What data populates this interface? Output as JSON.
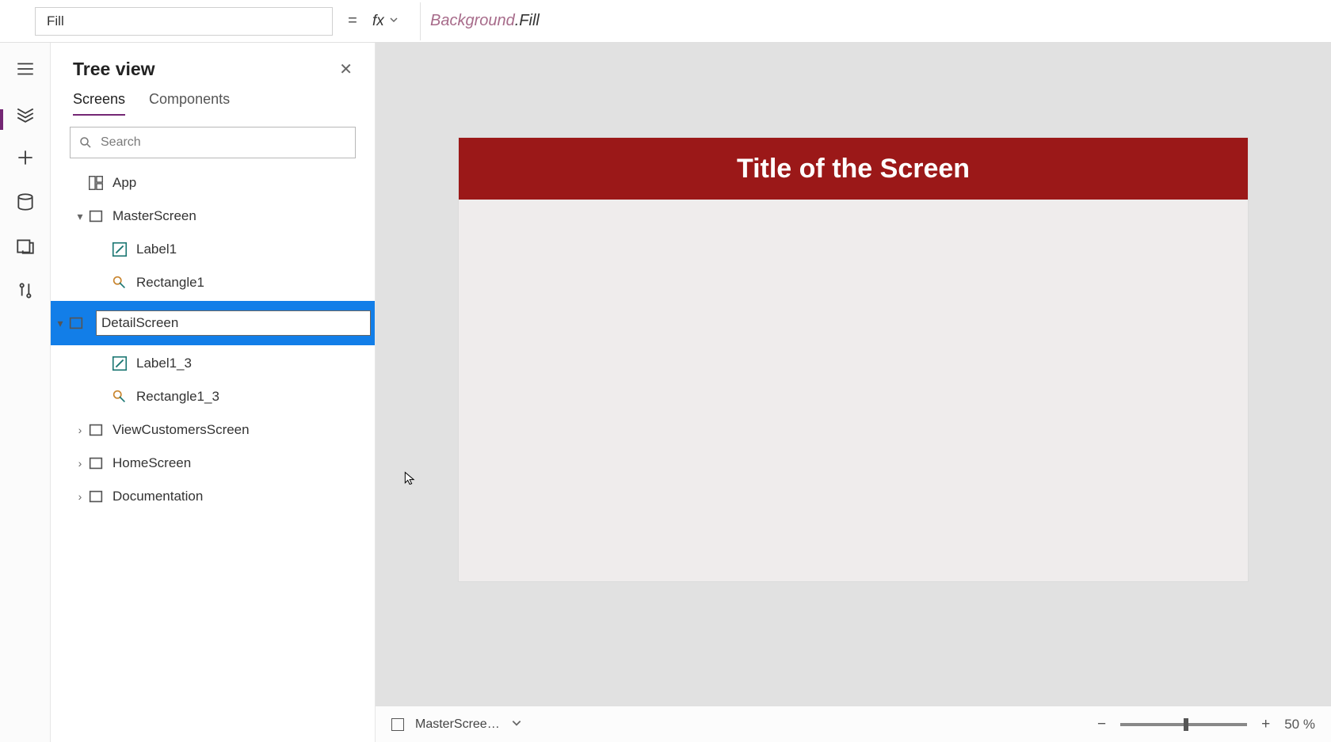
{
  "formulaBar": {
    "propertyName": "Fill",
    "fxLabel": "fx",
    "formulaObject": "Background",
    "formulaProperty": ".Fill"
  },
  "treePanel": {
    "title": "Tree view",
    "tabs": {
      "screens": "Screens",
      "components": "Components"
    },
    "searchPlaceholder": "Search",
    "appNode": "App",
    "items": [
      {
        "name": "MasterScreen"
      },
      {
        "name": "Label1"
      },
      {
        "name": "Rectangle1"
      },
      {
        "name": "DetailScreen"
      },
      {
        "name": "Label1_3"
      },
      {
        "name": "Rectangle1_3"
      },
      {
        "name": "ViewCustomersScreen"
      },
      {
        "name": "HomeScreen"
      },
      {
        "name": "Documentation"
      }
    ]
  },
  "canvas": {
    "headerTitle": "Title of the Screen"
  },
  "statusBar": {
    "screenName": "MasterScree…",
    "zoomValue": "50",
    "zoomUnit": "%"
  }
}
